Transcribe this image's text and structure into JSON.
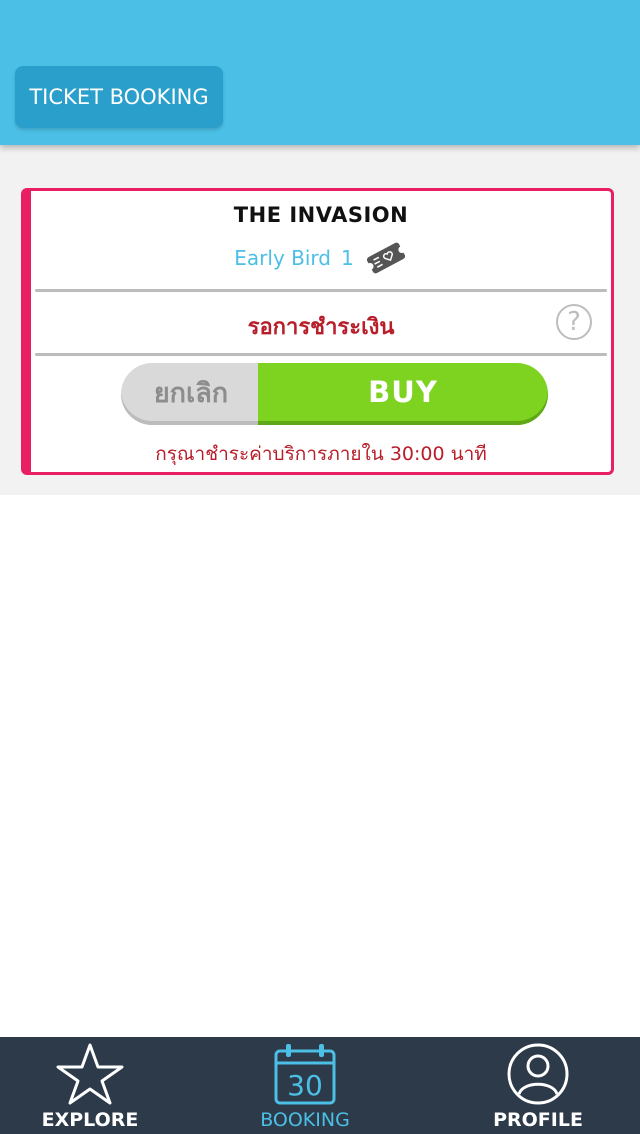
{
  "header": {
    "tab_label": "TICKET BOOKING"
  },
  "card": {
    "title": "THE INVASION",
    "ticket_type": "Early Bird",
    "ticket_count": "1",
    "status": "รอการชำระเงิน",
    "cancel_label": "ยกเลิก",
    "buy_label": "BUY",
    "note": "กรุณาชำระค่าบริการภายใน 30:00 นาที"
  },
  "tabbar": {
    "items": [
      {
        "label": "EXPLORE",
        "icon": "star-icon"
      },
      {
        "label": "BOOKING",
        "icon": "calendar-icon",
        "calendar_day": "30"
      },
      {
        "label": "PROFILE",
        "icon": "user-icon"
      }
    ],
    "active": "BOOKING"
  },
  "colors": {
    "header": "#4bbfe5",
    "accent_pink": "#e91e63",
    "buy_green": "#7ed321",
    "status_red": "#b81d2a",
    "tabbar": "#2d3a49"
  }
}
